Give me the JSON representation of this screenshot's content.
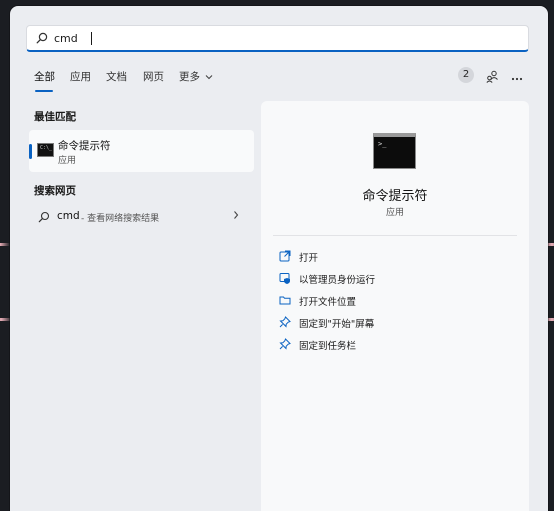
{
  "search": {
    "value": "cmd",
    "icon": "search-icon"
  },
  "tabs": [
    {
      "label": "全部",
      "active": true
    },
    {
      "label": "应用"
    },
    {
      "label": "文档"
    },
    {
      "label": "网页"
    },
    {
      "label": "更多"
    }
  ],
  "header_right": {
    "badge": "2"
  },
  "best_match": {
    "section": "最佳匹配",
    "title": "命令提示符",
    "subtitle": "应用"
  },
  "web": {
    "section": "搜索网页",
    "query": "cmd",
    "hint": "- 查看网络搜索结果"
  },
  "detail": {
    "title": "命令提示符",
    "subtitle": "应用",
    "actions": [
      {
        "label": "打开",
        "icon": "open-external-icon"
      },
      {
        "label": "以管理员身份运行",
        "icon": "shield-admin-icon"
      },
      {
        "label": "打开文件位置",
        "icon": "folder-icon"
      },
      {
        "label": "固定到\"开始\"屏幕",
        "icon": "pin-icon"
      },
      {
        "label": "固定到任务栏",
        "icon": "pin-icon"
      }
    ]
  },
  "colors": {
    "accent": "#0a62c2",
    "panel": "#ebedf1",
    "pane": "#f8f9fa"
  }
}
